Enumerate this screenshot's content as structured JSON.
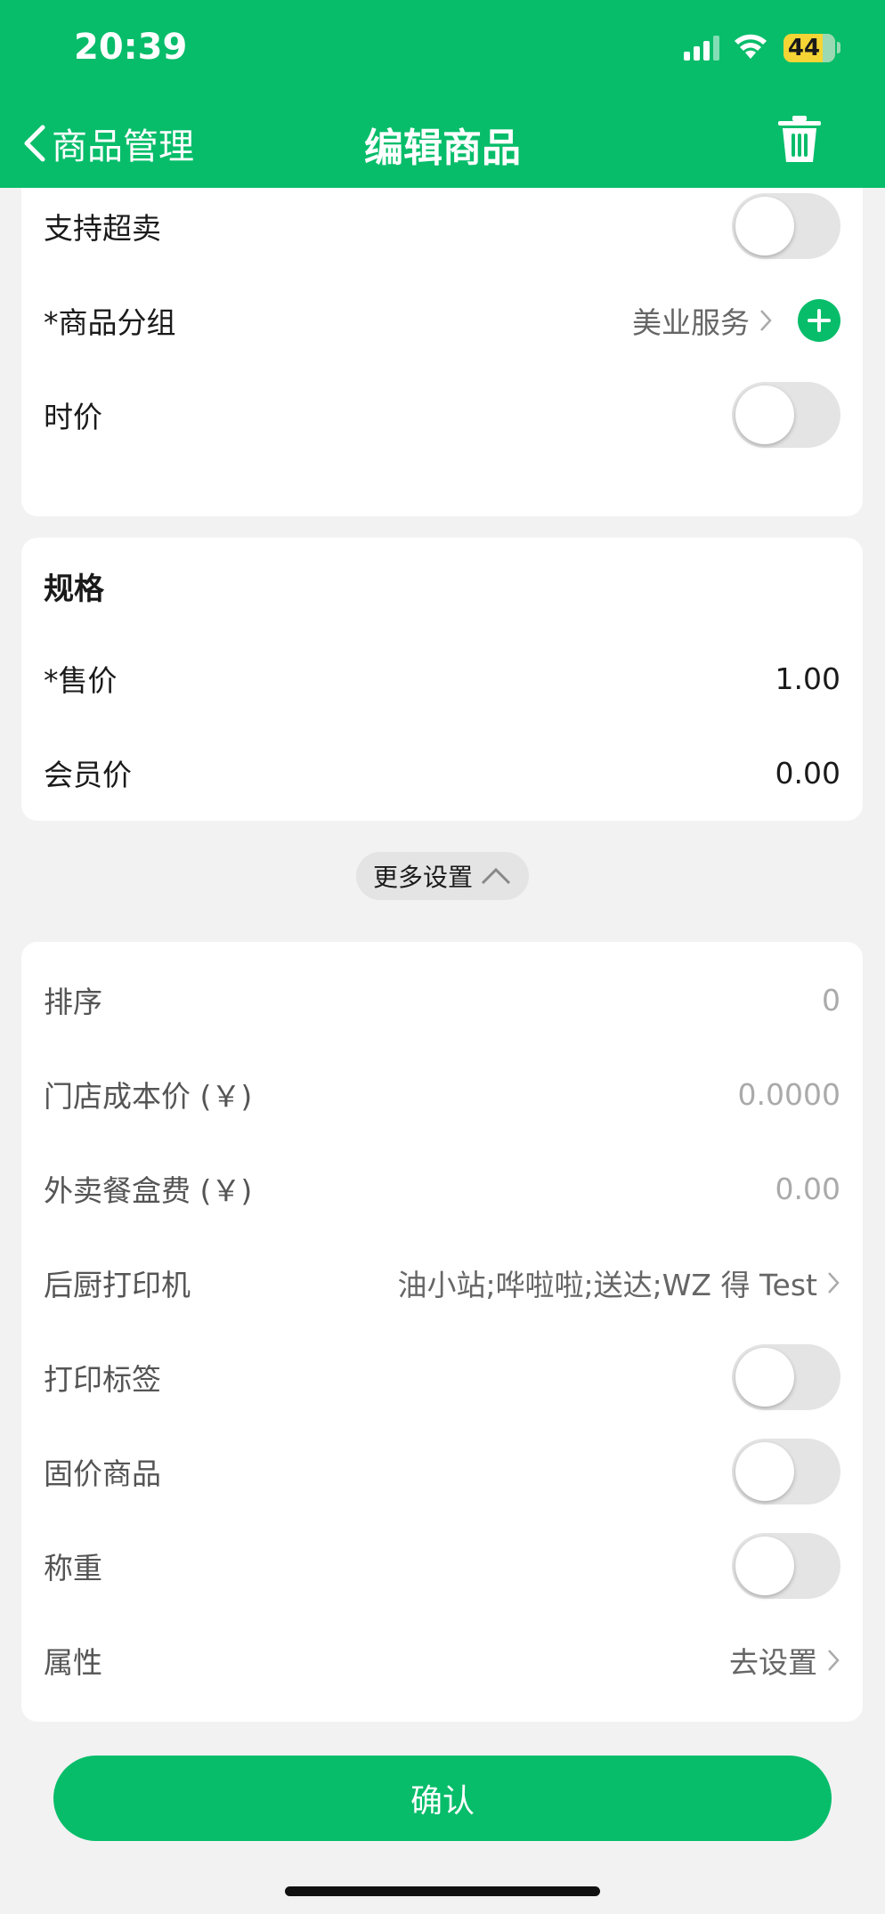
{
  "status_bar": {
    "time": "20:39",
    "battery": "44"
  },
  "nav": {
    "back_label": "商品管理",
    "title": "编辑商品"
  },
  "card1": {
    "oversell_label": "支持超卖",
    "group_label": "*商品分组",
    "group_value": "美业服务",
    "time_price_label": "时价"
  },
  "spec": {
    "title": "规格",
    "price_label": "*售价",
    "price_value": "1.00",
    "member_price_label": "会员价",
    "member_price_value": "0.00"
  },
  "more_settings": {
    "label": "更多设置"
  },
  "extra": {
    "sort_label": "排序",
    "sort_placeholder": "0",
    "cost_label": "门店成本价 (￥)",
    "cost_placeholder": "0.0000",
    "box_fee_label": "外卖餐盒费 (￥)",
    "box_fee_placeholder": "0.00",
    "printer_label": "后厨打印机",
    "printer_value": "油小站;哗啦啦;送达;WZ 得 Test",
    "print_tag_label": "打印标签",
    "fixed_price_label": "固价商品",
    "weigh_label": "称重",
    "attr_label": "属性",
    "attr_value": "去设置"
  },
  "confirm_label": "确认",
  "colors": {
    "brand_green": "#07bd6a",
    "battery_yellow": "#f4d535"
  }
}
